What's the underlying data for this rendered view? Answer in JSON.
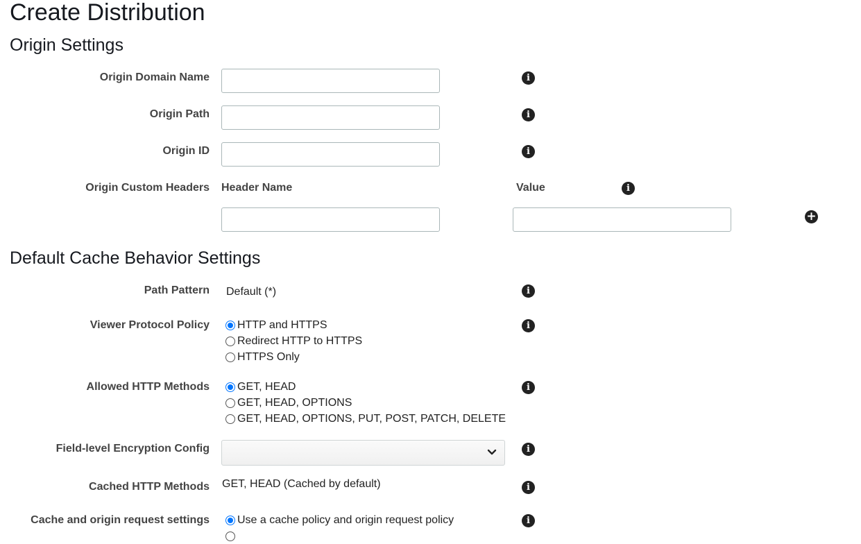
{
  "page": {
    "title": "Create Distribution"
  },
  "origin_settings": {
    "heading": "Origin Settings",
    "origin_domain_name": {
      "label": "Origin Domain Name",
      "value": ""
    },
    "origin_path": {
      "label": "Origin Path",
      "value": ""
    },
    "origin_id": {
      "label": "Origin ID",
      "value": ""
    },
    "custom_headers": {
      "label": "Origin Custom Headers",
      "col_header_name": "Header Name",
      "col_value": "Value",
      "header_name_value": "",
      "value_value": ""
    }
  },
  "cache_behavior": {
    "heading": "Default Cache Behavior Settings",
    "path_pattern": {
      "label": "Path Pattern",
      "value": "Default (*)"
    },
    "viewer_protocol_policy": {
      "label": "Viewer Protocol Policy",
      "options": [
        "HTTP and HTTPS",
        "Redirect HTTP to HTTPS",
        "HTTPS Only"
      ],
      "selected": "HTTP and HTTPS"
    },
    "allowed_http_methods": {
      "label": "Allowed HTTP Methods",
      "options": [
        "GET, HEAD",
        "GET, HEAD, OPTIONS",
        "GET, HEAD, OPTIONS, PUT, POST, PATCH, DELETE"
      ],
      "selected": "GET, HEAD"
    },
    "field_level_encryption": {
      "label": "Field-level Encryption Config",
      "value": ""
    },
    "cached_http_methods": {
      "label": "Cached HTTP Methods",
      "value": "GET, HEAD (Cached by default)"
    },
    "cache_origin_request": {
      "label": "Cache and origin request settings",
      "options": [
        "Use a cache policy and origin request policy"
      ],
      "selected": "Use a cache policy and origin request policy"
    }
  },
  "icons": {
    "info": "info-icon",
    "add": "plus-circle-icon",
    "chevron": "chevron-down-icon"
  },
  "colors": {
    "radio_accent": "#0075ff",
    "border": "#aab7b8"
  }
}
